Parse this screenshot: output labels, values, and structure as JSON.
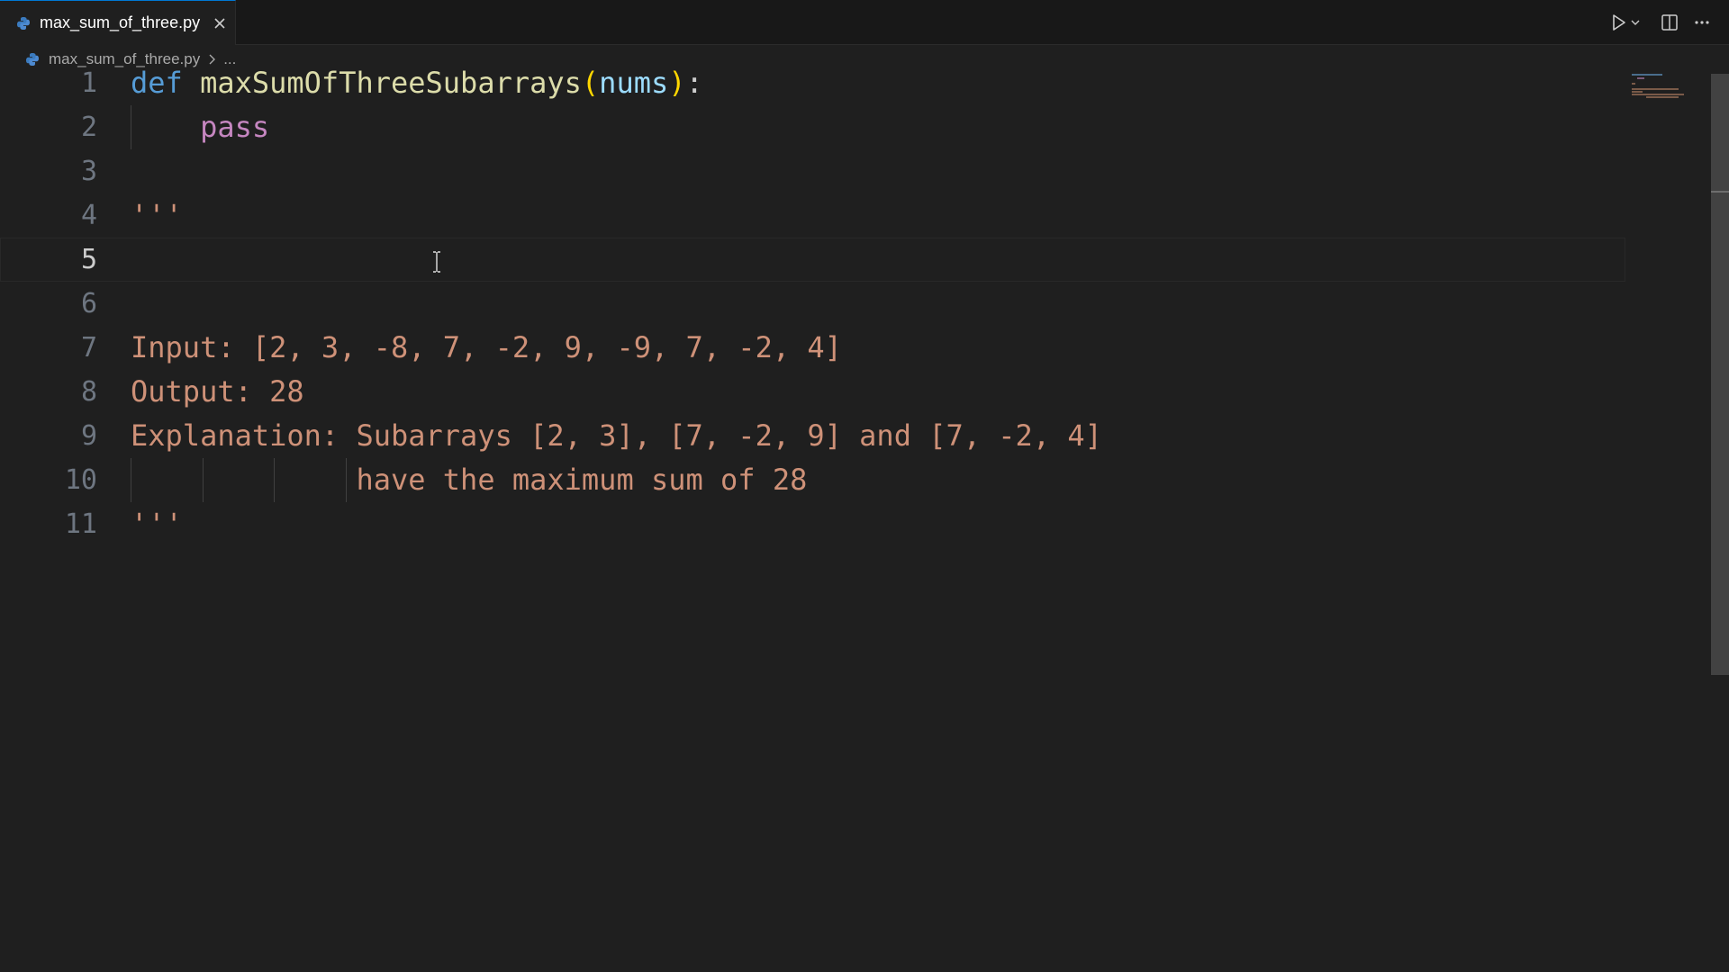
{
  "tab": {
    "label": "max_sum_of_three.py",
    "icon": "python-file-icon",
    "close_icon": "close-icon"
  },
  "toolbar": {
    "run_icon": "play-icon",
    "run_menu_icon": "chevron-down-icon",
    "split_icon": "split-editor-icon",
    "more_icon": "ellipsis-icon"
  },
  "breadcrumb": {
    "file": "max_sum_of_three.py",
    "more": "..."
  },
  "editor": {
    "current_line": 5,
    "lines": [
      {
        "num": "1",
        "tokens": [
          {
            "t": "def",
            "c": "kw"
          },
          {
            "t": " ",
            "c": ""
          },
          {
            "t": "maxSumOfThreeSubarrays",
            "c": "fn"
          },
          {
            "t": "(",
            "c": "par"
          },
          {
            "t": "nums",
            "c": "prm"
          },
          {
            "t": ")",
            "c": "par"
          },
          {
            "t": ":",
            "c": ""
          }
        ]
      },
      {
        "num": "2",
        "tokens": [
          {
            "t": "    ",
            "c": ""
          },
          {
            "t": "pass",
            "c": "ctl"
          }
        ]
      },
      {
        "num": "3",
        "tokens": []
      },
      {
        "num": "4",
        "tokens": [
          {
            "t": "'''",
            "c": "str"
          }
        ]
      },
      {
        "num": "5",
        "tokens": []
      },
      {
        "num": "6",
        "tokens": []
      },
      {
        "num": "7",
        "tokens": [
          {
            "t": "Input: [2, 3, -8, 7, -2, 9, -9, 7, -2, 4]",
            "c": "str"
          }
        ]
      },
      {
        "num": "8",
        "tokens": [
          {
            "t": "Output: 28",
            "c": "str"
          }
        ]
      },
      {
        "num": "9",
        "tokens": [
          {
            "t": "Explanation: Subarrays [2, 3], [7, -2, 9] and [7, -2, 4]",
            "c": "str"
          }
        ]
      },
      {
        "num": "10",
        "tokens": [
          {
            "t": "             have the maximum sum of 28",
            "c": "str"
          }
        ]
      },
      {
        "num": "11",
        "tokens": [
          {
            "t": "'''",
            "c": "str"
          }
        ]
      }
    ]
  },
  "colors": {
    "background": "#1f1f1f",
    "keyword": "#569cd6",
    "function": "#dcdcaa",
    "string": "#ce9178",
    "control": "#c586c0",
    "parameter": "#9cdcfe"
  }
}
